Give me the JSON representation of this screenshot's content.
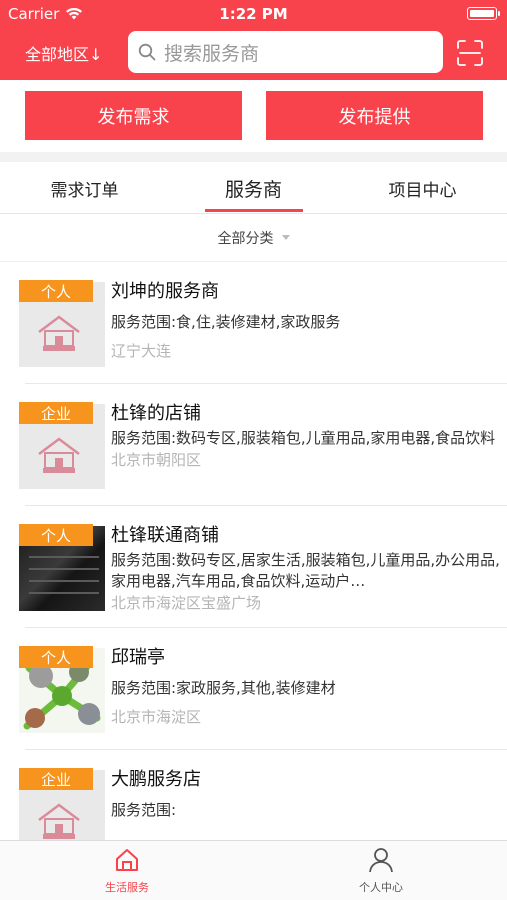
{
  "status_bar": {
    "carrier": "Carrier",
    "time": "1:22 PM"
  },
  "header": {
    "region_label": "全部地区↓",
    "search_placeholder": "搜索服务商"
  },
  "actions": {
    "publish_demand": "发布需求",
    "publish_offer": "发布提供"
  },
  "tabs": [
    {
      "label": "需求订单",
      "active": false
    },
    {
      "label": "服务商",
      "active": true
    },
    {
      "label": "项目中心",
      "active": false
    }
  ],
  "filter": {
    "label": "全部分类"
  },
  "providers": [
    {
      "badge": "个人",
      "name": "刘坤的服务商",
      "scope": "服务范围:食,住,装修建材,家政服务",
      "location": "辽宁大连",
      "thumb": "placeholder-logo"
    },
    {
      "badge": "企业",
      "name": "杜锋的店铺",
      "scope": "服务范围:数码专区,服装箱包,儿童用品,家用电器,食品饮料",
      "location": "北京市朝阳区",
      "thumb": "placeholder-logo"
    },
    {
      "badge": "个人",
      "name": "杜锋联通商铺",
      "scope": "服务范围:数码专区,居家生活,服装箱包,儿童用品,办公用品,家用电器,汽车用品,食品饮料,运动户…",
      "location": "北京市海淀区宝盛广场",
      "thumb": "keyboard-photo"
    },
    {
      "badge": "个人",
      "name": "邱瑞亭",
      "scope": "服务范围:家政服务,其他,装修建材",
      "location": "北京市海淀区",
      "thumb": "people-photo"
    },
    {
      "badge": "企业",
      "name": "大鹏服务店",
      "scope": "服务范围:",
      "location": "",
      "thumb": "placeholder-logo"
    }
  ],
  "bottom_nav": [
    {
      "label": "生活服务",
      "icon": "home-icon",
      "active": true
    },
    {
      "label": "个人中心",
      "icon": "person-icon",
      "active": false
    }
  ],
  "colors": {
    "brand": "#f9434c",
    "badge": "#f7941d"
  }
}
